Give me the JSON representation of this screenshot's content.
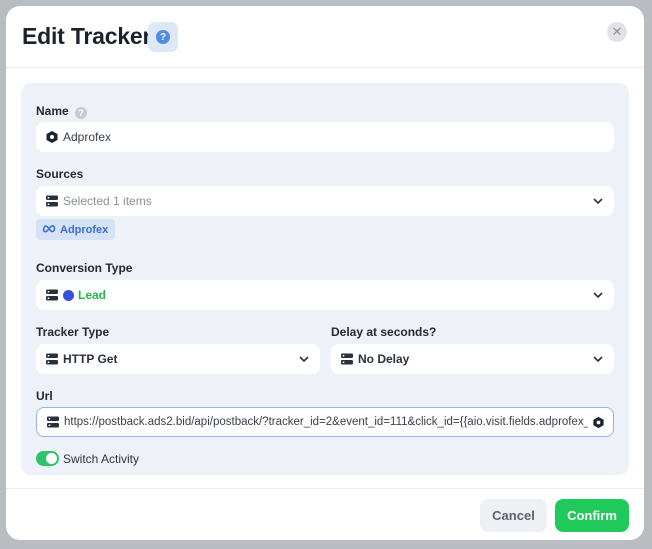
{
  "modal": {
    "title": "Edit Tracker",
    "help_icon": "question-circle-icon",
    "close_icon": "close-icon"
  },
  "form": {
    "name": {
      "label": "Name",
      "value": "Adprofex"
    },
    "sources": {
      "label": "Sources",
      "placeholder": "Selected 1 items",
      "selected_tags": [
        "Adprofex"
      ]
    },
    "conversion_type": {
      "label": "Conversion Type",
      "value": "Lead",
      "dot_color": "#3550d8"
    },
    "tracker_type": {
      "label": "Tracker Type",
      "value": "HTTP Get"
    },
    "delay": {
      "label": "Delay at seconds?",
      "value": "No Delay"
    },
    "url": {
      "label": "Url",
      "value": "https://postback.ads2.bid/api/postback/?tracker_id=2&event_id=111&click_id={{aio.visit.fields.adprofex_"
    },
    "switch": {
      "label": "Switch Activity",
      "on": true
    }
  },
  "buttons": {
    "cancel": "Cancel",
    "confirm": "Confirm"
  },
  "colors": {
    "accent_green": "#1fca5b",
    "accent_blue": "#4f8de6",
    "lead_green": "#28b44a"
  }
}
